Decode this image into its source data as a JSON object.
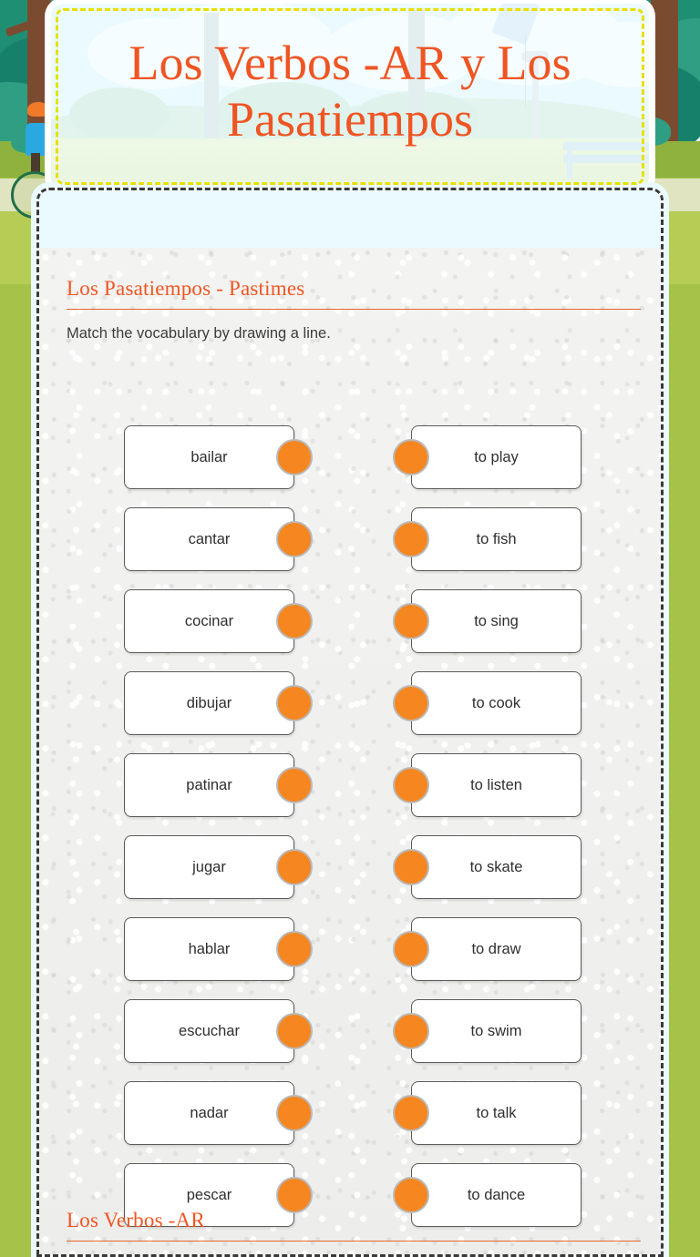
{
  "header": {
    "title": "Los Verbos -AR y Los Pasatiempos",
    "accent_color": "#ef5523",
    "border_color": "#e8e000",
    "card_background": "#eafaff"
  },
  "worksheet": {
    "panel_background": "#efefed",
    "dot_color": "#f6861f",
    "sections": [
      {
        "heading": "Los Pasatiempos - Pastimes",
        "instruction": "Match the vocabulary by drawing a line.",
        "pairs": [
          {
            "left": "bailar",
            "right": "to play"
          },
          {
            "left": "cantar",
            "right": "to fish"
          },
          {
            "left": "cocinar",
            "right": "to sing"
          },
          {
            "left": "dibujar",
            "right": "to cook"
          },
          {
            "left": "patinar",
            "right": "to listen"
          },
          {
            "left": "jugar",
            "right": "to skate"
          },
          {
            "left": "hablar",
            "right": "to draw"
          },
          {
            "left": "escuchar",
            "right": "to swim"
          },
          {
            "left": "nadar",
            "right": "to talk"
          },
          {
            "left": "pescar",
            "right": "to dance"
          }
        ]
      },
      {
        "heading": "Los Verbos -AR",
        "instruction": "",
        "pairs": []
      }
    ]
  },
  "background": {
    "scene": "park-illustration",
    "grass_color": "#a5c249",
    "tree_trunk_color": "#7b4b30",
    "foliage_color": "#2f9e82"
  }
}
